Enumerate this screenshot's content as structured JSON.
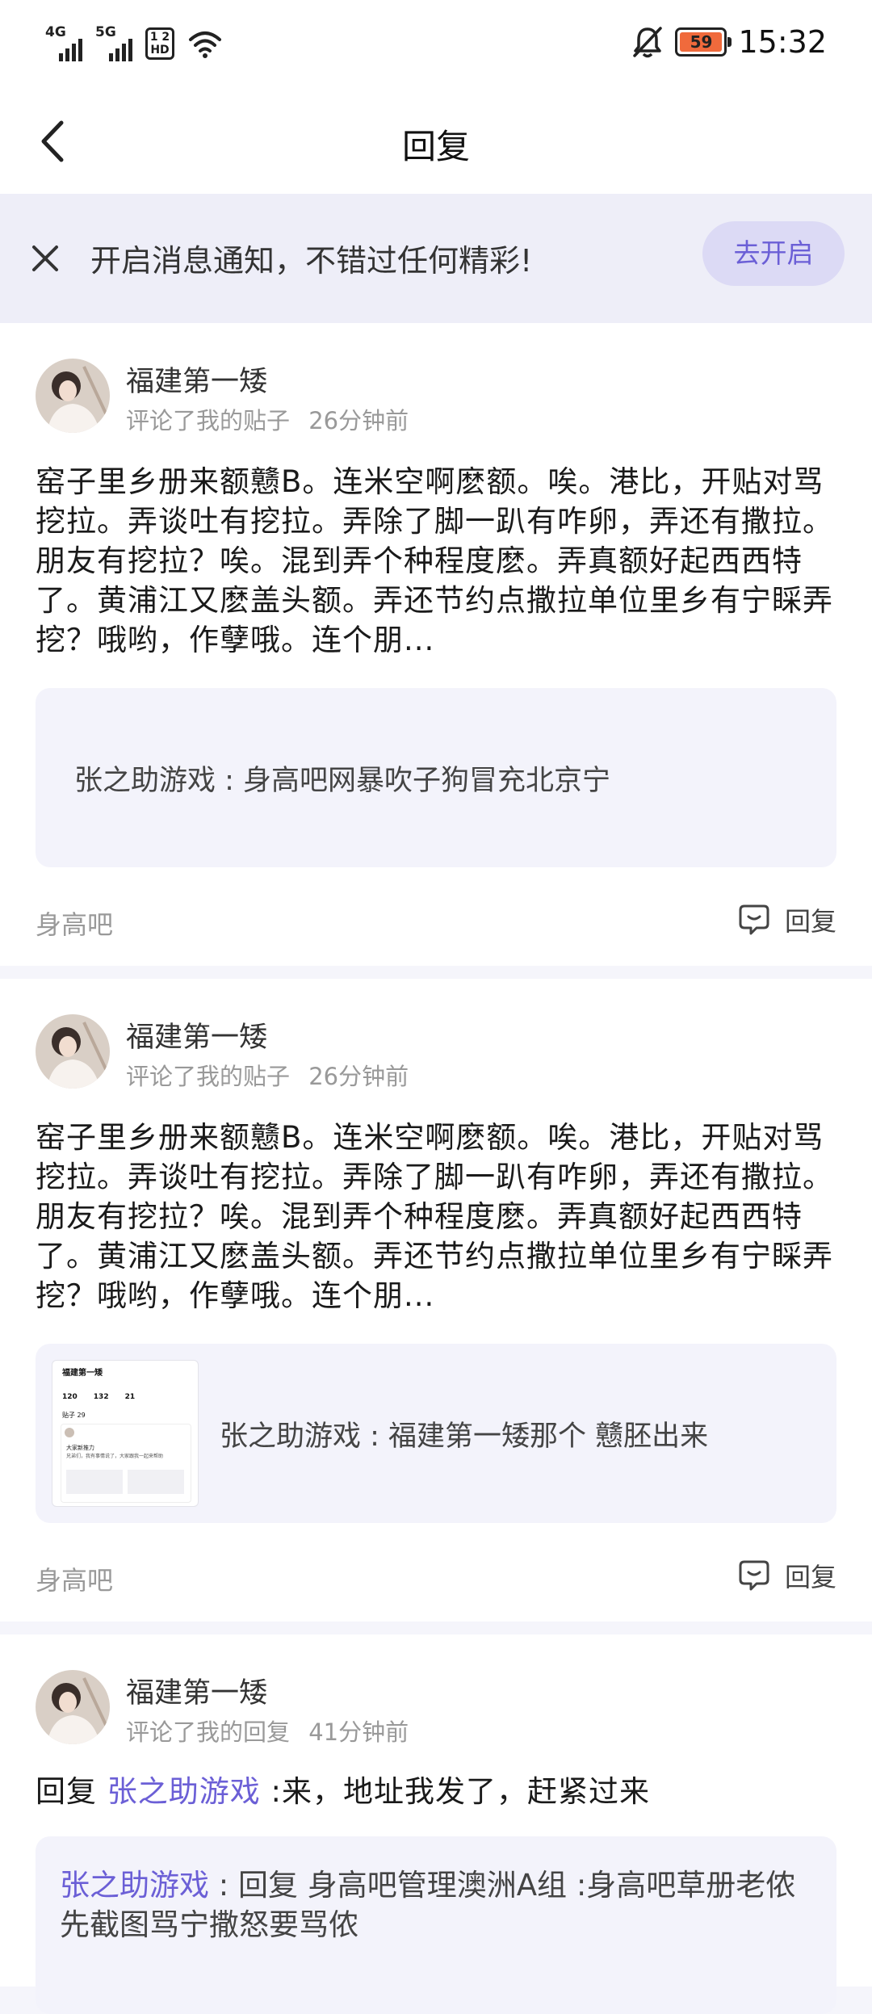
{
  "status_bar": {
    "signal1_label": "4G",
    "signal2_label": "5G",
    "hd_label": "1 2\nHD",
    "battery_level": "59",
    "time": "15:32"
  },
  "header": {
    "title": "回复",
    "back_icon": "chevron-left-icon"
  },
  "notification_banner": {
    "text": "开启消息通知，不错过任何精彩!",
    "button_label": "去开启",
    "close_icon": "close-icon"
  },
  "colors": {
    "accent": "#6b5fd6",
    "banner_bg": "#eeeef8",
    "quote_bg": "#f3f3fb"
  },
  "items": [
    {
      "user": "福建第一矮",
      "action": "评论了我的贴子",
      "time": "26分钟前",
      "content": "窑子里乡册来额戆B。连米空啊麽额。唉。港比，开贴对骂挖拉。弄谈吐有挖拉。弄除了脚一趴有咋卵，弄还有撒拉。朋友有挖拉？唉。混到弄个种程度麽。弄真额好起西西特了。黄浦江又麽盖头额。弄还节约点撒拉单位里乡有宁睬弄挖？哦哟，作孽哦。连个朋...",
      "quote": "张之助游戏 : 身高吧网暴吹子狗冒充北京宁",
      "forum": "身高吧",
      "reply_label": "回复"
    },
    {
      "user": "福建第一矮",
      "action": "评论了我的贴子",
      "time": "26分钟前",
      "content": "窑子里乡册来额戆B。连米空啊麽额。唉。港比，开贴对骂挖拉。弄谈吐有挖拉。弄除了脚一趴有咋卵，弄还有撒拉。朋友有挖拉？唉。混到弄个种程度麽。弄真额好起西西特了。黄浦江又麽盖头额。弄还节约点撒拉单位里乡有宁睬弄挖？哦哟，作孽哦。连个朋...",
      "quote": "张之助游戏 : 福建第一矮那个  戆胚出来",
      "thumb": {
        "title": "福建第一矮",
        "stat1": "120",
        "stat2": "132",
        "stat3": "21",
        "section": "贴子 29",
        "line1": "大家新推力",
        "line2": "兄弟们，我有事情说了，大家跟我一起来帮助"
      },
      "forum": "身高吧",
      "reply_label": "回复"
    },
    {
      "user": "福建第一矮",
      "action": "评论了我的回复",
      "time": "41分钟前",
      "reply_prefix": "回复",
      "reply_target": "张之助游戏",
      "reply_text": ":来，地址我发了，赶紧过来",
      "quote_link": "张之助游戏",
      "quote_rest": " : 回复 身高吧管理澳洲A组 :身高吧草册老侬先截图骂宁撒怒要骂侬"
    }
  ]
}
